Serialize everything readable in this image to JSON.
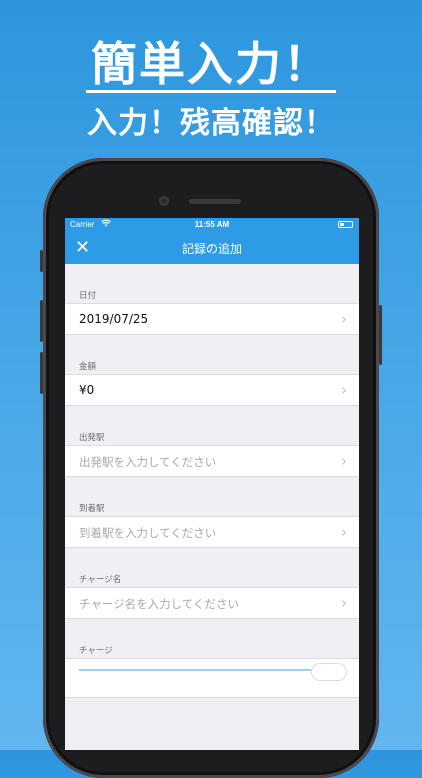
{
  "promo": {
    "headline": "簡単入力！",
    "subheadline": "入力！残高確認！"
  },
  "status_bar": {
    "carrier": "Carrier",
    "time": "11:55 AM"
  },
  "navbar": {
    "close_label": "✕",
    "title": "記録の追加"
  },
  "form": {
    "date": {
      "label": "日付",
      "value": "2019/07/25"
    },
    "amount": {
      "label": "金額",
      "value": "¥0"
    },
    "departure": {
      "label": "出発駅",
      "placeholder": "出発駅を入力してください"
    },
    "arrival": {
      "label": "到着駅",
      "placeholder": "到着駅を入力してください"
    },
    "charge_name": {
      "label": "チャージ名",
      "placeholder": "チャージ名を入力してください"
    },
    "charge": {
      "label": "チャージ"
    }
  },
  "icons": {
    "close": "close-icon",
    "chevron": "chevron-right-icon",
    "wifi": "wifi-icon",
    "battery": "battery-icon"
  },
  "colors": {
    "accent": "#2e9be6",
    "background": "#efeff4"
  }
}
